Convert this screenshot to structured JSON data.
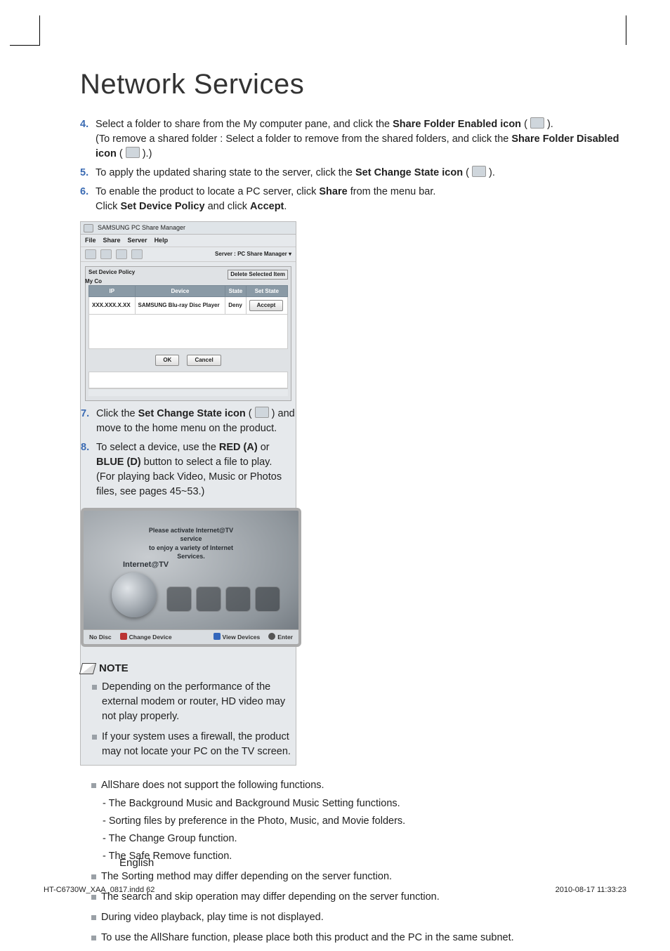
{
  "title": "Network Services",
  "steps": [
    {
      "num": "4.",
      "pre": "Select a folder to share from the My computer pane, and click the ",
      "bold1": "Share Folder Enabled icon",
      "mid": " ( ",
      "icon": true,
      "post": " ).",
      "extra1": "(To remove a shared folder : Select a folder to remove from the shared folders, and click the ",
      "bold2": "Share Folder Disabled icon",
      "extra2": " ( ",
      "extra3": " ).)"
    },
    {
      "num": "5.",
      "pre": "To apply the updated sharing state to the server, click the ",
      "bold1": "Set Change State icon",
      "mid": " ( ",
      "icon": true,
      "post": " )."
    },
    {
      "num": "6.",
      "pre": "To enable the product to locate a PC server, click ",
      "bold1": "Share",
      "mid": " from the menu bar.",
      "line2a": "Click ",
      "bold2": "Set Device Policy",
      "line2b": " and click ",
      "bold3": "Accept",
      "line2c": "."
    },
    {
      "num": "7.",
      "pre": "Click the ",
      "bold1": "Set Change State icon",
      "mid": " ( ",
      "icon": true,
      "post": " ) and move to the home menu on the product."
    },
    {
      "num": "8.",
      "pre": "To select a device, use the ",
      "bold1": "RED (A)",
      "mid": " or ",
      "bold2": "BLUE (D)",
      "post": " button to select a file to play.",
      "extra1": "(For playing back Video, Music or Photos files, see pages 45~53.)"
    }
  ],
  "fig1": {
    "title": "SAMSUNG PC Share Manager",
    "menu": [
      "File",
      "Share",
      "Server",
      "Help"
    ],
    "server_label": "Server : PC Share Manager  ▾",
    "panel_title": "Set Device Policy",
    "sidebar": "My Co",
    "delete_btn": "Delete Selected Item",
    "headers": [
      "IP",
      "Device",
      "State",
      "Set State"
    ],
    "row": {
      "ip": "XXX.XXX.X.XX",
      "device": "SAMSUNG Blu-ray Disc Player",
      "state": "Deny",
      "set": "Accept"
    },
    "ok": "OK",
    "cancel": "Cancel"
  },
  "fig2": {
    "msg1": "Please activate Internet@TV service",
    "msg2": "to enjoy a variety of Internet Services.",
    "label": "Internet@TV",
    "bar": {
      "nodisc": "No Disc",
      "a": "Change Device",
      "d": "View Devices",
      "enter": "Enter"
    }
  },
  "note_label": "NOTE",
  "notes_left": [
    "Depending on the performance of the external modem or router, HD video may not play properly.",
    "If your system uses a firewall, the product may not locate your PC on the TV screen."
  ],
  "notes_right": [
    {
      "text": "AllShare does not support the following functions.",
      "subs": [
        "- The Background Music and Background Music Setting functions.",
        "- Sorting files by preference in the Photo, Music, and Movie folders.",
        "- The Change Group function.",
        "- The Safe Remove function."
      ]
    },
    {
      "text": "The Sorting method may differ depending on the server function."
    },
    {
      "text": "The search and skip operation may differ depending on the server function."
    },
    {
      "text": "During video playback, play time is not displayed."
    },
    {
      "text": "To use the AllShare function, please place both this product and the PC in the same subnet."
    }
  ],
  "lang": "English",
  "footer_left": "HT-C6730W_XAA_0817.indd   62",
  "footer_right": "2010-08-17    11:33:23"
}
